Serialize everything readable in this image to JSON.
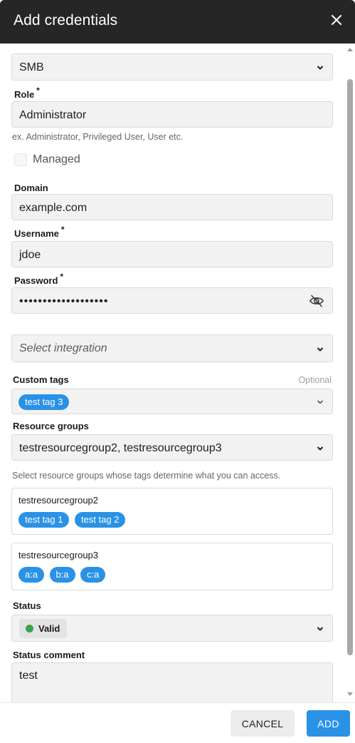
{
  "dialog": {
    "title": "Add credentials"
  },
  "type_select": {
    "value": "SMB"
  },
  "role": {
    "label": "Role",
    "required": "*",
    "value": "Administrator",
    "hint": "ex. Administrator, Privileged User, User etc."
  },
  "managed": {
    "label": "Managed",
    "checked": false
  },
  "domain": {
    "label": "Domain",
    "value": "example.com"
  },
  "username": {
    "label": "Username",
    "required": "*",
    "value": "jdoe"
  },
  "password": {
    "label": "Password",
    "required": "*",
    "value": "•••••••••••••••••••"
  },
  "integration": {
    "placeholder": "Select integration"
  },
  "custom_tags": {
    "label": "Custom tags",
    "optional": "Optional",
    "tags": [
      "test tag 3"
    ]
  },
  "resource_groups": {
    "label": "Resource groups",
    "value": "testresourcegroup2, testresourcegroup3",
    "hint": "Select resource groups whose tags determine what you can access.",
    "groups": [
      {
        "name": "testresourcegroup2",
        "tags": [
          "test tag 1",
          "test tag 2"
        ]
      },
      {
        "name": "testresourcegroup3",
        "tags": [
          "a:a",
          "b:a",
          "c:a"
        ]
      }
    ]
  },
  "status": {
    "label": "Status",
    "value": "Valid",
    "color": "#3aa24a"
  },
  "status_comment": {
    "label": "Status comment",
    "value": "test"
  },
  "footer": {
    "cancel_label": "CANCEL",
    "add_label": "ADD"
  },
  "colors": {
    "header_bg": "#262626",
    "accent": "#2a92e6"
  }
}
